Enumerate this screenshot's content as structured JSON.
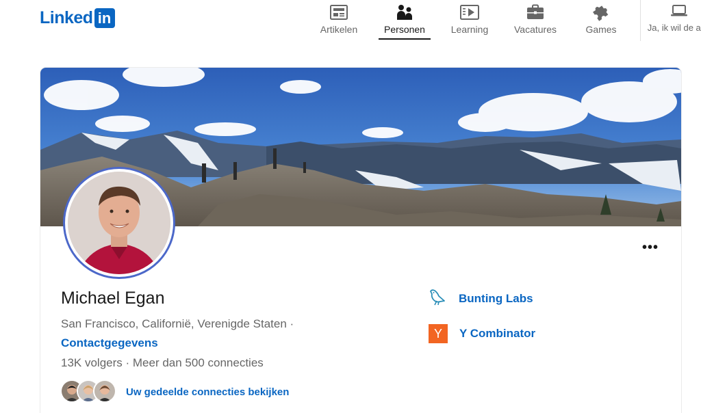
{
  "header": {
    "logo_text": "Linked",
    "logo_box": "in",
    "nav": [
      {
        "label": "Artikelen",
        "icon": "articles-icon"
      },
      {
        "label": "Personen",
        "icon": "people-icon",
        "active": true
      },
      {
        "label": "Learning",
        "icon": "learning-icon"
      },
      {
        "label": "Vacatures",
        "icon": "jobs-icon"
      },
      {
        "label": "Games",
        "icon": "games-icon"
      }
    ],
    "app_label": "Ja, ik wil de app"
  },
  "profile": {
    "name": "Michael Egan",
    "location": "San Francisco, Californië, Verenigde Staten  ·",
    "contact_label": "Contactgegevens",
    "stats": "13K volgers  ·  Meer dan 500 connecties",
    "shared_connections_label": "Uw gedeelde connecties bekijken",
    "more_label": "•••"
  },
  "organizations": [
    {
      "name": "Bunting Labs",
      "icon": "bird-icon"
    },
    {
      "name": "Y Combinator",
      "logo": "Y",
      "color": "#f26522"
    }
  ],
  "colors": {
    "brand": "#0a66c2",
    "avatar_ring": "#4c68c9"
  }
}
